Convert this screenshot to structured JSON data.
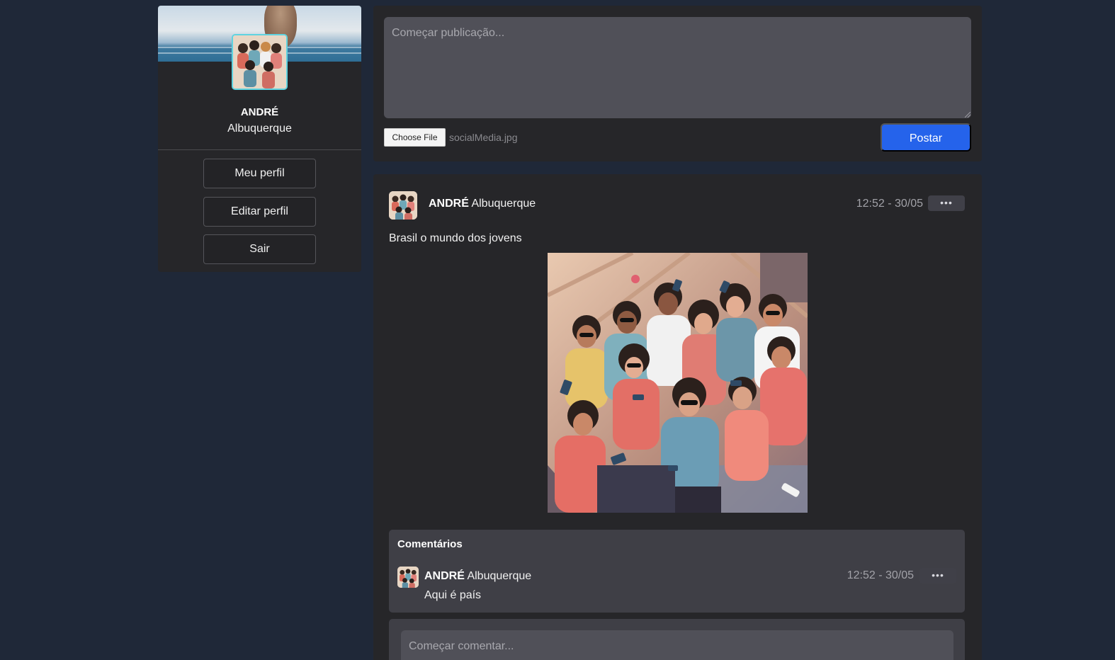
{
  "profile": {
    "first_name": "ANDRÉ",
    "last_name": "Albuquerque",
    "buttons": {
      "my_profile": "Meu perfil",
      "edit_profile": "Editar perfil",
      "logout": "Sair"
    }
  },
  "composer": {
    "placeholder": "Começar publicação...",
    "file_button": "Choose File",
    "file_name": "socialMedia.jpg",
    "post_button": "Postar"
  },
  "post": {
    "author_first": "ANDRÉ",
    "author_last": "Albuquerque",
    "timestamp": "12:52 - 30/05",
    "menu": "•••",
    "text": "Brasil o mundo dos jovens",
    "comments_title": "Comentários",
    "comments": [
      {
        "author_first": "ANDRÉ",
        "author_last": "Albuquerque",
        "timestamp": "12:52 - 30/05",
        "menu": "•••",
        "text": "Aqui é país"
      }
    ],
    "comment_placeholder": "Começar comentar..."
  },
  "colors": {
    "background": "#1f2838",
    "card": "#262629",
    "accent": "#2563eb",
    "avatar_border": "#5fd3e0"
  }
}
